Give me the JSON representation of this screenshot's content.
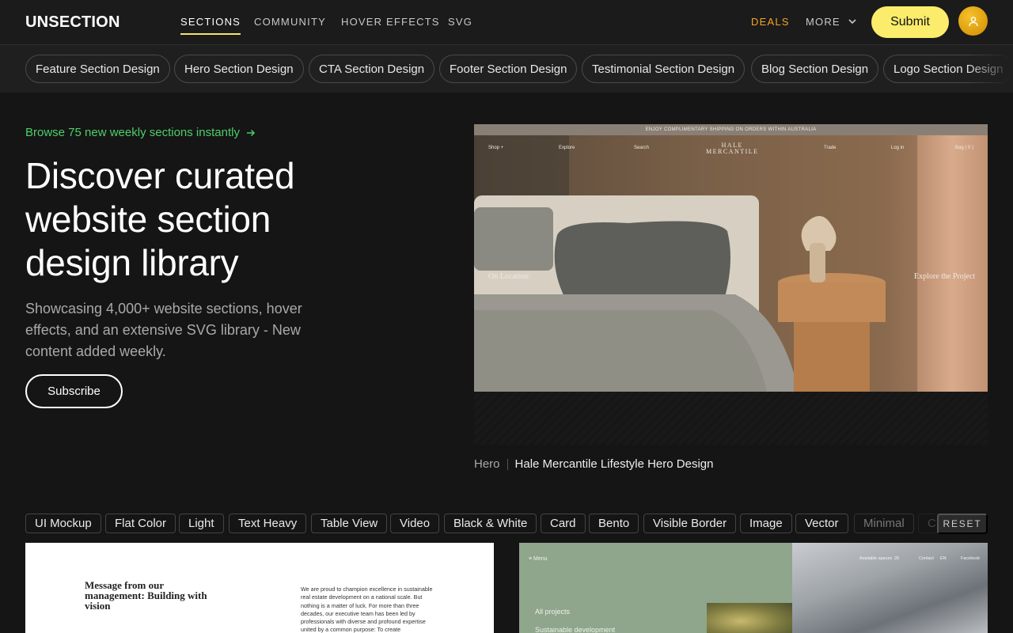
{
  "header": {
    "logo": "UNSECTION",
    "nav": [
      {
        "label": "SECTIONS",
        "active": true
      },
      {
        "label": "COMMUNITY",
        "active": false
      },
      {
        "label": "HOVER EFFECTS",
        "active": false
      },
      {
        "label": "SVG",
        "active": false
      }
    ],
    "deals": "DEALS",
    "more": "MORE",
    "more_icon": "chevron-down-icon",
    "submit": "Submit",
    "avatar_icon": "user-icon",
    "colors": {
      "accent": "#fbec6b",
      "deals": "#f5a524",
      "avatar": "#f0b31c"
    }
  },
  "categories": [
    "Feature Section Design",
    "Hero Section Design",
    "CTA Section Design",
    "Footer Section Design",
    "Testimonial Section Design",
    "Blog Section Design",
    "Logo Section Design"
  ],
  "hero": {
    "browse_link": "Browse 75 new weekly sections instantly",
    "browse_icon": "arrow-right-icon",
    "browse_color": "#4ccf6a",
    "headline": "Discover curated website section design library",
    "description": "Showcasing 4,000+ website sections, hover effects, and an extensive SVG library - New content added weekly.",
    "subscribe": "Subscribe"
  },
  "featured": {
    "shipping_bar": "ENJOY COMPLIMENTARY SHIPPING ON ORDERS WITHIN AUSTRALIA",
    "nav_left": [
      "Shop +",
      "Explore",
      "Search"
    ],
    "brand_line1": "HALE",
    "brand_line2": "MERCANTILE",
    "nav_right": [
      "Trade",
      "Log in",
      "Bag ( 0 )"
    ],
    "left_text": "On Location:",
    "right_text": "Explore the Project",
    "category": "Hero",
    "title": "Hale Mercantile Lifestyle Hero Design"
  },
  "filters": {
    "tags": [
      "UI Mockup",
      "Flat Color",
      "Light",
      "Text Heavy",
      "Table View",
      "Video",
      "Black & White",
      "Card",
      "Bento",
      "Visible Border",
      "Image",
      "Vector",
      "Minimal",
      "C"
    ],
    "reset": "RESET"
  },
  "cards": {
    "card1": {
      "title": "Message from our management: Building with vision",
      "body": "We are proud to champion excellence in sustainable real estate development on a national scale. But nothing is a matter of luck. For more than three decades, our executive team has been led by professionals with diverse and profound expertise united by a common purpose: To create"
    },
    "card2": {
      "menu": "≡ Menu",
      "items": [
        "All projects",
        "Sustainable development"
      ],
      "nav": [
        "Available spaces",
        "26",
        "Contact",
        "EN",
        "Facebook"
      ]
    }
  }
}
